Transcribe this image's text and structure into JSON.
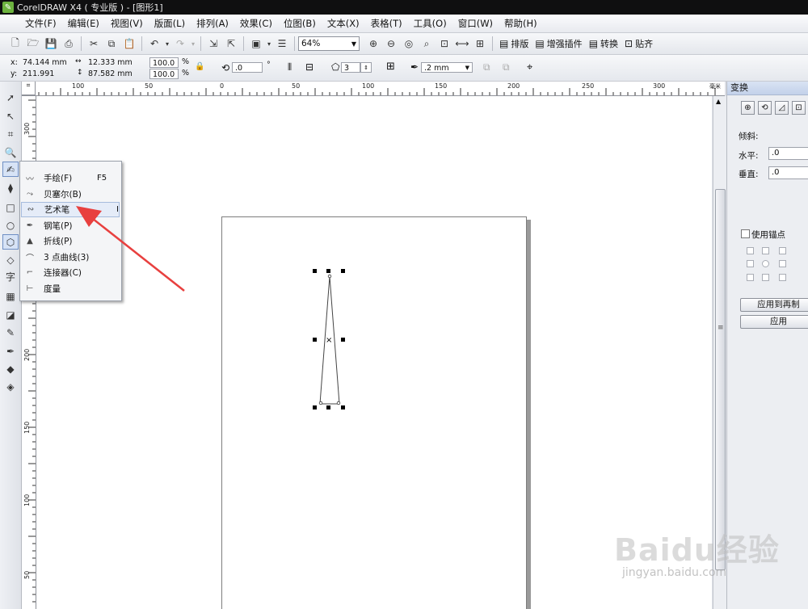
{
  "app": {
    "title": "CorelDRAW X4 ( 专业版 ) - [图形1]"
  },
  "menu": [
    "文件(F)",
    "编辑(E)",
    "视图(V)",
    "版面(L)",
    "排列(A)",
    "效果(C)",
    "位图(B)",
    "文本(X)",
    "表格(T)",
    "工具(O)",
    "窗口(W)",
    "帮助(H)"
  ],
  "toolbar": {
    "zoom": "64%",
    "buttons": [
      "排版",
      "增强插件",
      "转换",
      "贴齐"
    ]
  },
  "property_bar": {
    "x_label": "x:",
    "x_value": "74.144 mm",
    "y_label": "y:",
    "y_value": "211.991 mm",
    "width_value": "12.333 mm",
    "height_value": "87.582 mm",
    "scale_x": "100.0",
    "scale_y": "100.0",
    "percent": "%",
    "rotation": ".0",
    "degree": "°",
    "sides": "3",
    "outline_width": ".2 mm"
  },
  "hruler_labels": [
    "100",
    "50",
    "0",
    "50",
    "100",
    "150",
    "200",
    "250",
    "300",
    "毫米"
  ],
  "vruler_labels": [
    "300",
    "250",
    "200",
    "150",
    "100",
    "50"
  ],
  "flyout": {
    "items": [
      {
        "label": "手绘(F)",
        "shortcut": "F5",
        "icon": "freehand-icon"
      },
      {
        "label": "贝塞尔(B)",
        "shortcut": "",
        "icon": "bezier-icon"
      },
      {
        "label": "艺术笔",
        "shortcut": "I",
        "icon": "artistic-media-icon"
      },
      {
        "label": "钢笔(P)",
        "shortcut": "",
        "icon": "pen-icon"
      },
      {
        "label": "折线(P)",
        "shortcut": "",
        "icon": "polyline-icon"
      },
      {
        "label": "3 点曲线(3)",
        "shortcut": "",
        "icon": "three-point-curve-icon"
      },
      {
        "label": "连接器(C)",
        "shortcut": "",
        "icon": "connector-icon"
      },
      {
        "label": "度量",
        "shortcut": "",
        "icon": "dimension-icon"
      }
    ],
    "highlighted_index": 2
  },
  "docker": {
    "title": "变换",
    "skew_label": "倾斜:",
    "horizontal_label": "水平:",
    "horizontal_value": ".0",
    "vertical_label": "垂直:",
    "vertical_value": ".0",
    "use_anchor_label": "使用锚点",
    "apply_duplicate_label": "应用到再制",
    "apply_label": "应用"
  },
  "watermark": {
    "line1": "Baidu经验",
    "line2": "jingyan.baidu.com"
  },
  "colors": {
    "arrow": "#e8403f",
    "titlebar": "#0f0f10",
    "highlight": "#e5ecf8"
  }
}
